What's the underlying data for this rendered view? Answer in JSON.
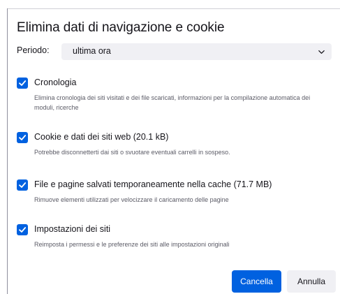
{
  "dialog": {
    "title": "Elimina dati di navigazione e cookie",
    "period": {
      "label": "Periodo:",
      "value": "ultima ora",
      "icon": "chevron-down-icon"
    },
    "options": [
      {
        "label": "Cronologia",
        "description": "Elimina cronologia dei siti visitati e dei file scaricati, informazioni per la compilazione automatica dei moduli, ricerche",
        "checked": true
      },
      {
        "label": "Cookie e dati dei siti web (20.1 kB)",
        "description": "Potrebbe disconnetterti dai siti o svuotare eventuali carrelli in sospeso.",
        "checked": true
      },
      {
        "label": "File e pagine salvati temporaneamente nella cache (71.7 MB)",
        "description": "Rimuove elementi utilizzati per velocizzare il caricamento delle pagine",
        "checked": true
      },
      {
        "label": "Impostazioni dei siti",
        "description": "Reimposta i permessi e le preferenze dei siti alle impostazioni originali",
        "checked": true
      }
    ],
    "buttons": {
      "primary": "Cancella",
      "secondary": "Annulla"
    }
  },
  "colors": {
    "accent": "#0061e0",
    "secondary_button_bg": "#f0f0f4",
    "text": "#15141a",
    "muted_text": "#5b5b66"
  }
}
